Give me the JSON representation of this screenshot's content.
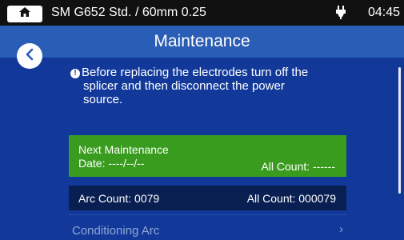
{
  "topbar": {
    "home_icon": "home-icon",
    "device_title": "SM G652 Std. / 60mm 0.25",
    "power_icon": "plug-icon",
    "time": "04:45"
  },
  "header": {
    "title": "Maintenance",
    "back_icon": "chevron-left-icon"
  },
  "notice": {
    "icon": "info-icon",
    "line1": "Before replacing the electrodes turn off the",
    "line2": "splicer and then disconnect the power",
    "line3": "source."
  },
  "maintenance": {
    "label": "Next Maintenance",
    "date": "Date: ----/--/--",
    "all_count": "All Count: ------"
  },
  "arc": {
    "arc_count": "Arc Count: 0079",
    "all_count": "All Count: 000079"
  },
  "menu": {
    "conditioning_arc": "Conditioning Arc",
    "chevron": "›"
  },
  "colors": {
    "main_bg": "#12399a",
    "header_bg": "#2a5db5",
    "maintenance_bg": "#3a9c1f",
    "arc_bg": "#091f52"
  }
}
